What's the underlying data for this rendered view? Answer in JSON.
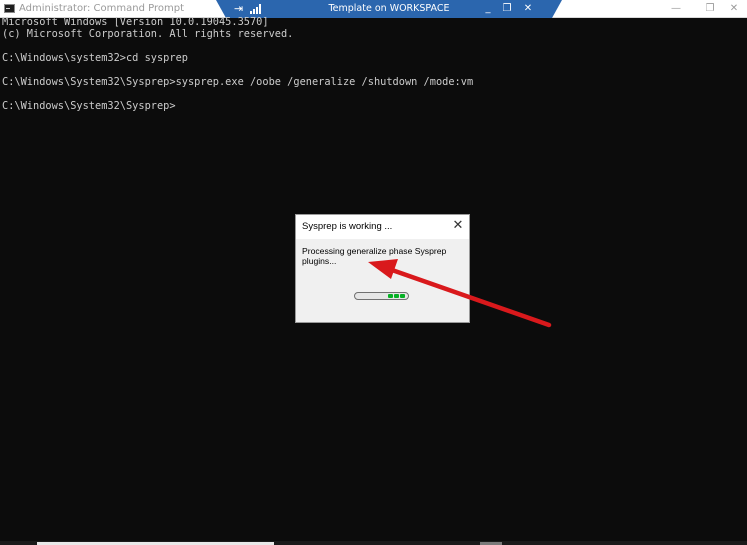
{
  "window": {
    "title": "Administrator: Command Prompt",
    "icon": "cmd-icon"
  },
  "window_controls": {
    "minimize": "—",
    "maximize": "❐",
    "close": "✕"
  },
  "remote_bar": {
    "title": "Template on WORKSPACE",
    "pin_icon": "pin-icon",
    "signal_icon": "connection-signal-icon",
    "minimize": "_",
    "restore": "❐",
    "close": "✕",
    "color": "#2b66ae"
  },
  "console": {
    "lines": [
      "Microsoft Windows [Version 10.0.19045.3570]",
      "(c) Microsoft Corporation. All rights reserved.",
      "",
      "C:\\Windows\\system32>cd sysprep",
      "",
      "C:\\Windows\\System32\\Sysprep>sysprep.exe /oobe /generalize /shutdown /mode:vm",
      "",
      "C:\\Windows\\System32\\Sysprep>"
    ],
    "text_color": "#cccccc",
    "background": "#0c0c0c"
  },
  "dialog": {
    "title": "Sysprep is working ...",
    "close": "✕",
    "message": "Processing generalize phase Sysprep plugins...",
    "progress_color": "#06b025"
  },
  "annotation": {
    "arrow_color": "#d9191c"
  }
}
